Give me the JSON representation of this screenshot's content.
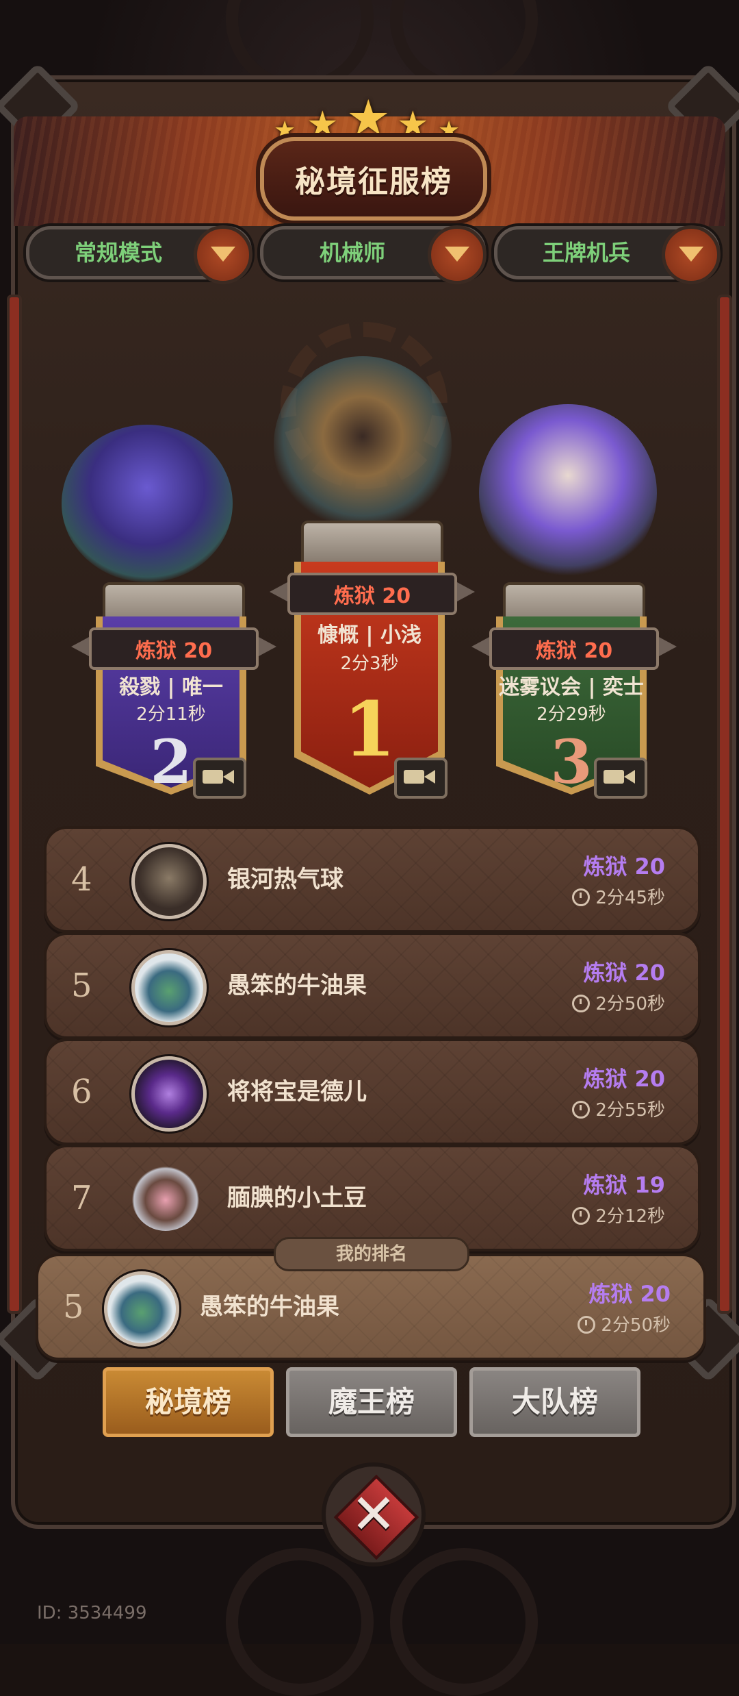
{
  "header": {
    "title": "秘境征服榜",
    "stars": 5
  },
  "filters": [
    {
      "label": "常规模式"
    },
    {
      "label": "机械师"
    },
    {
      "label": "王牌机兵"
    }
  ],
  "podium": [
    {
      "rank": "1",
      "level": "炼狱 20",
      "names": "慷慨 | 小浅",
      "time": "2分3秒"
    },
    {
      "rank": "2",
      "level": "炼狱 20",
      "names": "殺戮 | 唯一",
      "time": "2分11秒"
    },
    {
      "rank": "3",
      "level": "炼狱 20",
      "names": "迷雾议会 | 奕士",
      "time": "2分29秒"
    }
  ],
  "list": [
    {
      "rank": "4",
      "name": "银河热气球",
      "level": "炼狱 20",
      "time": "2分45秒"
    },
    {
      "rank": "5",
      "name": "愚笨的牛油果",
      "level": "炼狱 20",
      "time": "2分50秒"
    },
    {
      "rank": "6",
      "name": "将将宝是德儿",
      "level": "炼狱 20",
      "time": "2分55秒"
    },
    {
      "rank": "7",
      "name": "腼腆的小土豆",
      "level": "炼狱 19",
      "time": "2分12秒"
    }
  ],
  "my_rank": {
    "tab_label": "我的排名",
    "rank": "5",
    "name": "愚笨的牛油果",
    "level": "炼狱 20",
    "time": "2分50秒"
  },
  "tabs": [
    {
      "label": "秘境榜",
      "active": true
    },
    {
      "label": "魔王榜",
      "active": false
    },
    {
      "label": "大队榜",
      "active": false
    }
  ],
  "footer": {
    "id_text": "ID: 3534499"
  },
  "colors": {
    "accent_orange": "#c98a34",
    "level_purple": "#b57df0",
    "level_red": "#ff6d4e",
    "filter_green": "#7ed07a"
  }
}
